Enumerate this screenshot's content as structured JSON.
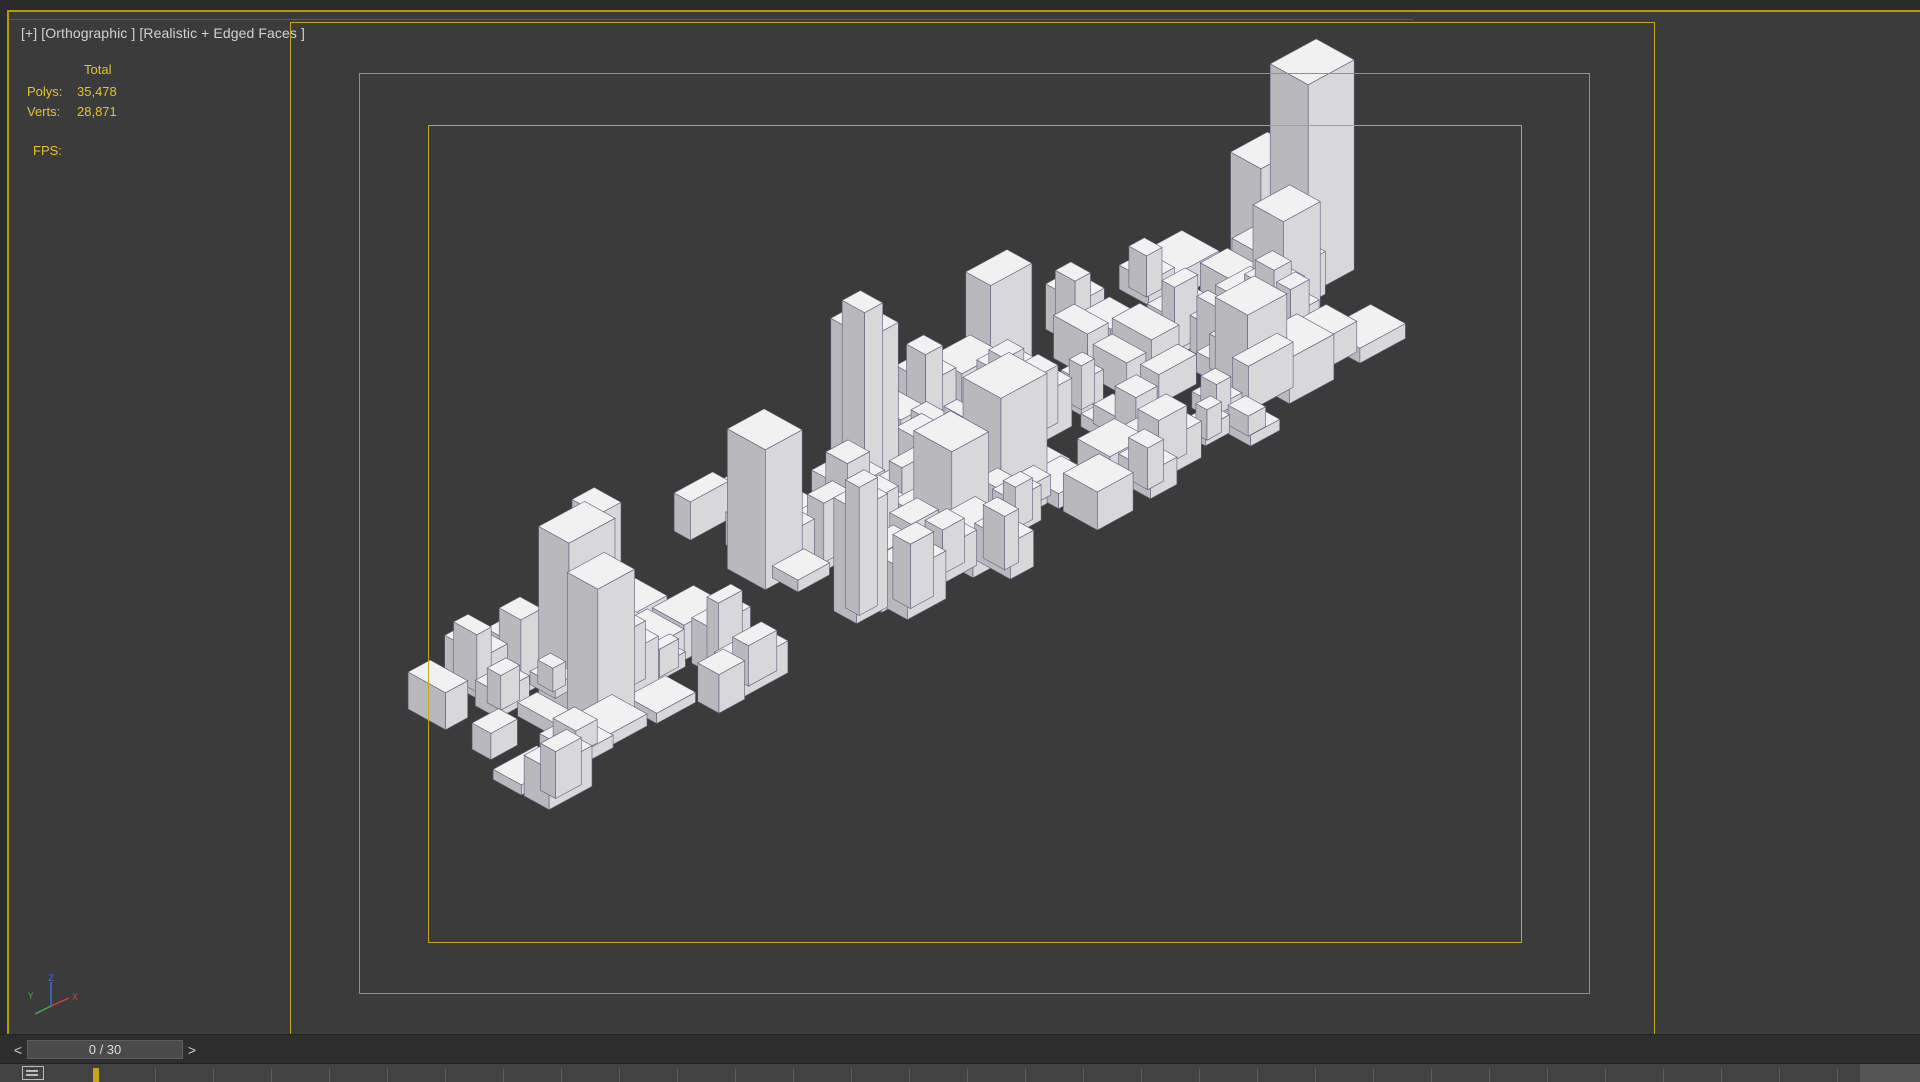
{
  "viewport": {
    "label_plus": "[+]",
    "label_view": "[Orthographic ]",
    "label_shading": "[Realistic + Edged Faces ]",
    "stats": {
      "header": "Total",
      "polys_label": "Polys:",
      "polys_value": "35,478",
      "verts_label": "Verts:",
      "verts_value": "28,871",
      "fps_label": "FPS:"
    }
  },
  "gizmo": {
    "z": "Z",
    "y": "Y",
    "x": "X"
  },
  "timeline": {
    "prev": "<",
    "next": ">",
    "frame": "0 / 30"
  },
  "colors": {
    "safe_frame_yellow": "#c8a41a",
    "safe_frame_cyan": "#2fb7c8",
    "stats_text": "#e6c22f",
    "viewport_bg": "#3b3b3b"
  }
}
